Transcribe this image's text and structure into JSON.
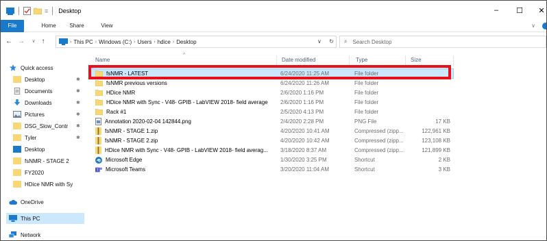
{
  "titlebar": {
    "title": "Desktop",
    "qat_sep": "=",
    "controls": {
      "minimize": "–",
      "maximize": "☐",
      "close": "✕"
    }
  },
  "ribbon": {
    "tabs": [
      {
        "label": "File"
      },
      {
        "label": "Home"
      },
      {
        "label": "Share"
      },
      {
        "label": "View"
      }
    ],
    "expand": "∨"
  },
  "address": {
    "back": "←",
    "forward": "→",
    "recent": "∨",
    "up": "↑",
    "crumbs": [
      "This PC",
      "Windows (C:)",
      "Users",
      "hdice",
      "Desktop"
    ],
    "dropdown": "∨",
    "refresh": "↻",
    "search_placeholder": "Search Desktop",
    "search_icon": "⌕"
  },
  "nav": {
    "items": [
      {
        "label": "Quick access",
        "icon": "star-icon",
        "pinned": false
      },
      {
        "label": "Desktop",
        "icon": "folder-icon",
        "pinned": true
      },
      {
        "label": "Documents",
        "icon": "documents-icon",
        "pinned": true
      },
      {
        "label": "Downloads",
        "icon": "download-icon",
        "pinned": true
      },
      {
        "label": "Pictures",
        "icon": "pictures-icon",
        "pinned": true
      },
      {
        "label": "DSG_Slow_Contr",
        "icon": "folder-icon",
        "pinned": true
      },
      {
        "label": "Tyler",
        "icon": "folder-icon",
        "pinned": true
      },
      {
        "label": "Desktop",
        "icon": "desktop-icon",
        "pinned": false
      },
      {
        "label": "fsNMR - STAGE 2",
        "icon": "folder-icon",
        "pinned": false
      },
      {
        "label": "FY2020",
        "icon": "folder-icon",
        "pinned": false
      },
      {
        "label": "HDice NMR with Sy",
        "icon": "folder-icon",
        "pinned": false
      },
      {
        "label": "OneDrive",
        "icon": "cloud-icon",
        "pinned": false
      },
      {
        "label": "This PC",
        "icon": "pc-icon",
        "pinned": false
      },
      {
        "label": "Network",
        "icon": "network-icon",
        "pinned": false
      }
    ],
    "pin_glyph": "✱"
  },
  "columns": {
    "name": "Name",
    "date": "Date modified",
    "type": "Type",
    "size": "Size",
    "sort_glyph": "^"
  },
  "files": [
    {
      "name": "fsNMR - LATEST",
      "date": "6/24/2020 11:25 AM",
      "type": "File folder",
      "size": "",
      "icon": "folder-icon"
    },
    {
      "name": "fsNMR previous versions",
      "date": "6/24/2020 11:26 AM",
      "type": "File folder",
      "size": "",
      "icon": "folder-icon"
    },
    {
      "name": "HDice NMR",
      "date": "2/6/2020 1:16 PM",
      "type": "File folder",
      "size": "",
      "icon": "folder-icon"
    },
    {
      "name": "HDice NMR with Sync - V48- GPIB - LabVIEW 2018- field average",
      "date": "2/6/2020 1:16 PM",
      "type": "File folder",
      "size": "",
      "icon": "folder-icon"
    },
    {
      "name": "Rack #1",
      "date": "2/5/2020 4:13 PM",
      "type": "File folder",
      "size": "",
      "icon": "folder-icon"
    },
    {
      "name": "Annotation 2020-02-04 142844.png",
      "date": "2/4/2020 2:28 PM",
      "type": "PNG File",
      "size": "17 KB",
      "icon": "image-file-icon"
    },
    {
      "name": "fsNMR - STAGE 1.zip",
      "date": "4/20/2020 10:41 AM",
      "type": "Compressed (zipp...",
      "size": "122,961 KB",
      "icon": "zip-icon"
    },
    {
      "name": "fsNMR - STAGE 2.zip",
      "date": "4/20/2020 10:42 AM",
      "type": "Compressed (zipp...",
      "size": "123,108 KB",
      "icon": "zip-icon"
    },
    {
      "name": "HDice NMR with Sync - V48- GPIB - LabVIEW 2018- field averag...",
      "date": "3/18/2020 8:37 AM",
      "type": "Compressed (zipp...",
      "size": "121,899 KB",
      "icon": "zip-icon"
    },
    {
      "name": "Microsoft Edge",
      "date": "1/30/2020 3:25 PM",
      "type": "Shortcut",
      "size": "2 KB",
      "icon": "edge-icon"
    },
    {
      "name": "Microsoft Teams",
      "date": "3/20/2020 11:04 AM",
      "type": "Shortcut",
      "size": "3 KB",
      "icon": "teams-icon"
    }
  ],
  "colors": {
    "accent": "#1979ca",
    "folder": "#f8d775",
    "selection": "#cce8ff",
    "highlight_box": "#e8111b"
  }
}
